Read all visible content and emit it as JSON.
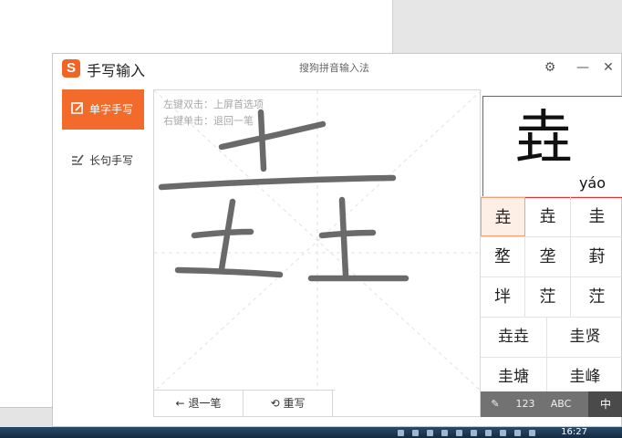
{
  "window": {
    "app_title": "手写输入",
    "ime_name": "搜狗拼音输入法",
    "logo_letter": "S"
  },
  "sidebar": {
    "items": [
      {
        "label": "单字手写",
        "active": true
      },
      {
        "label": "长句手写",
        "active": false
      }
    ]
  },
  "canvas": {
    "hints": [
      "左键双击：上屏首选项",
      "右键单击：退回一笔"
    ],
    "buttons": [
      {
        "icon": "undo-arrow-icon",
        "glyph": "←",
        "label": "退一笔"
      },
      {
        "icon": "rewrite-icon",
        "glyph": "⟲",
        "label": "重写"
      }
    ]
  },
  "preview": {
    "char": "垚",
    "pinyin": "yáo"
  },
  "candidates": {
    "rows": [
      [
        "垚",
        "垚",
        "圭"
      ],
      [
        "堥",
        "垄",
        "葑"
      ],
      [
        "坢",
        "茳",
        "茳"
      ],
      [
        "垚垚",
        "圭贤"
      ],
      [
        "圭塘",
        "圭峰"
      ]
    ],
    "selected": [
      0,
      0
    ]
  },
  "modes": [
    {
      "label": "✎",
      "active": false
    },
    {
      "label": "123",
      "active": false
    },
    {
      "label": "ABC",
      "active": false
    },
    {
      "label": "中",
      "active": true
    }
  ],
  "taskbar": {
    "clock": "16:27"
  },
  "colors": {
    "accent": "#f26b2b",
    "preview_border": "#e3322f"
  }
}
